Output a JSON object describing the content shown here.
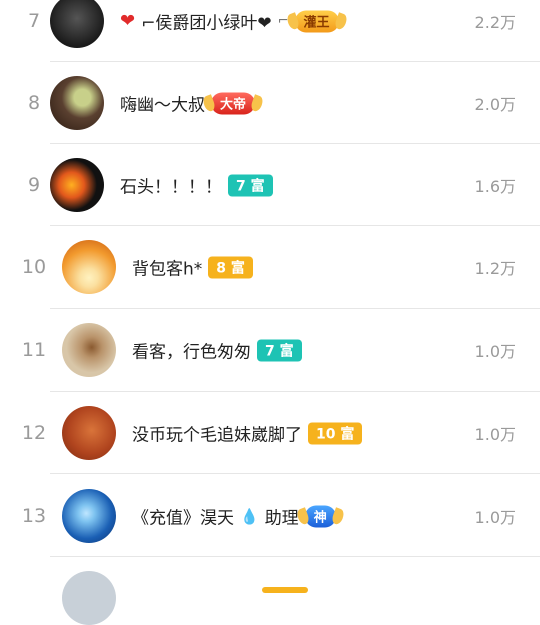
{
  "rows": [
    {
      "rank": "7",
      "name_parts": [
        "❤",
        "⌐侯爵团小绿叶❤",
        "⌐"
      ],
      "badge": {
        "type": "crown",
        "style": "gold",
        "label": "灌王"
      },
      "amount": "2.2万",
      "avatar_colors": [
        "#1a1a1a",
        "#555"
      ]
    },
    {
      "rank": "8",
      "name": "嗨幽～大叔",
      "badge": {
        "type": "crown",
        "style": "red",
        "label": "大帝"
      },
      "amount": "2.0万",
      "avatar_colors": [
        "#5a4030",
        "#c8d08a"
      ]
    },
    {
      "rank": "9",
      "name": "石头！！！！",
      "badge": {
        "type": "plain",
        "style": "teal",
        "label": "7 富"
      },
      "amount": "1.6万",
      "avatar_colors": [
        "#111",
        "#e2581c"
      ]
    },
    {
      "rank": "10",
      "name": "背包客h*",
      "badge": {
        "type": "plain",
        "style": "orange",
        "label": "8 富"
      },
      "amount": "1.2万",
      "avatar_colors": [
        "#f29a2e",
        "#fbe0a0"
      ]
    },
    {
      "rank": "11",
      "name": "看客，行色匆匆",
      "badge": {
        "type": "plain",
        "style": "teal",
        "label": "7 富"
      },
      "amount": "1.0万",
      "avatar_colors": [
        "#d8c6a8",
        "#8a5a30"
      ]
    },
    {
      "rank": "12",
      "name": "没币玩个毛追妹崴脚了",
      "badge": {
        "type": "plain",
        "style": "orange",
        "label": "10 富"
      },
      "amount": "1.0万",
      "avatar_colors": [
        "#b0441e",
        "#d9743a"
      ]
    },
    {
      "rank": "13",
      "name_parts": [
        "《充值》淏天",
        "💧",
        "助理"
      ],
      "badge": {
        "type": "crown",
        "style": "blue",
        "label": "神"
      },
      "amount": "1.0万",
      "avatar_colors": [
        "#1a5fb4",
        "#7ec3f0"
      ]
    }
  ]
}
